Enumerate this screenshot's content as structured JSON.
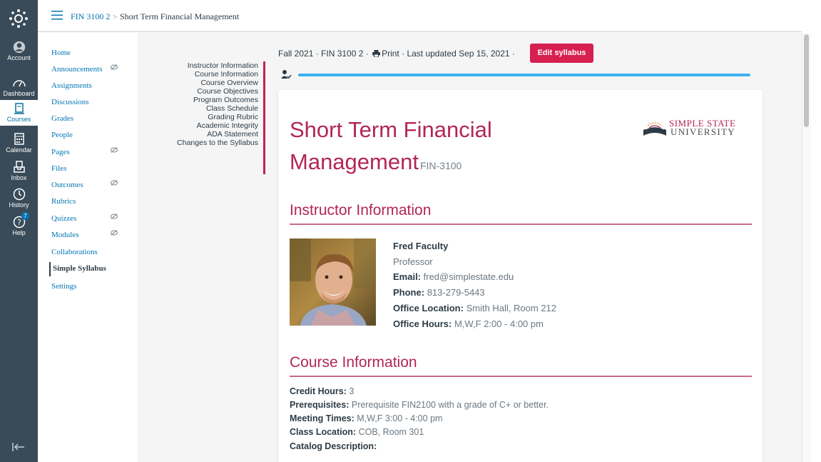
{
  "global_nav": {
    "items": [
      {
        "label": "Account",
        "icon": "account-icon"
      },
      {
        "label": "Dashboard",
        "icon": "dashboard-icon"
      },
      {
        "label": "Courses",
        "icon": "courses-icon"
      },
      {
        "label": "Calendar",
        "icon": "calendar-icon"
      },
      {
        "label": "Inbox",
        "icon": "inbox-icon"
      },
      {
        "label": "History",
        "icon": "history-icon"
      },
      {
        "label": "Help",
        "icon": "help-icon"
      }
    ],
    "help_badge": "7"
  },
  "breadcrumb": {
    "course": "FIN 3100 2",
    "separator": ">",
    "current": "Short Term Financial Management"
  },
  "course_nav": {
    "items": [
      {
        "label": "Home"
      },
      {
        "label": "Announcements"
      },
      {
        "label": "Assignments"
      },
      {
        "label": "Discussions"
      },
      {
        "label": "Grades"
      },
      {
        "label": "People"
      },
      {
        "label": "Pages"
      },
      {
        "label": "Files"
      },
      {
        "label": "Outcomes"
      },
      {
        "label": "Rubrics"
      },
      {
        "label": "Quizzes"
      },
      {
        "label": "Modules"
      },
      {
        "label": "Collaborations"
      },
      {
        "label": "Simple Syllabus"
      },
      {
        "label": "Settings"
      }
    ]
  },
  "toc": {
    "items": [
      "Instructor Information",
      "Course Information",
      "Course Overview",
      "Course Objectives",
      "Program Outcomes",
      "Class Schedule",
      "Grading Rubric",
      "Academic Integrity",
      "ADA Statement",
      "Changes to the Syllabus"
    ]
  },
  "syllabus_header": {
    "term_course": "Fall 2021 · FIN 3100 2 ·",
    "print_label": "Print",
    "updated": "· Last updated Sep 15, 2021 ·",
    "edit_button": "Edit syllabus"
  },
  "syllabus": {
    "title_line1": "Short Term Financial",
    "title_line2": "Management",
    "course_code": "FIN-3100",
    "university_line1": "SIMPLE STATE",
    "university_line2": "UNIVERSITY",
    "instructor": {
      "heading": "Instructor Information",
      "name": "Fred Faculty",
      "title": "Professor",
      "email_label": "Email:",
      "email": "fred@simplestate.edu",
      "phone_label": "Phone:",
      "phone": "813-279-5443",
      "office_location_label": "Office Location:",
      "office_location": "Smith Hall, Room 212",
      "office_hours_label": "Office Hours:",
      "office_hours": "M,W,F 2:00 - 4:00 pm"
    },
    "course_info": {
      "heading": "Course Information",
      "credit_hours_label": "Credit Hours:",
      "credit_hours": "3",
      "prerequisites_label": "Prerequisites:",
      "prerequisites": "Prerequisite FIN2100 with a grade of C+ or better.",
      "meeting_times_label": "Meeting Times:",
      "meeting_times": "M,W,F 3:00 - 4:00 pm",
      "class_location_label": "Class Location:",
      "class_location": "COB, Room 301",
      "catalog_description_label": "Catalog Description:"
    }
  },
  "colors": {
    "nav_bg": "#394b58",
    "link": "#0374b5",
    "accent": "#b32655",
    "button": "#d6204f",
    "progress": "#3db2f2"
  }
}
